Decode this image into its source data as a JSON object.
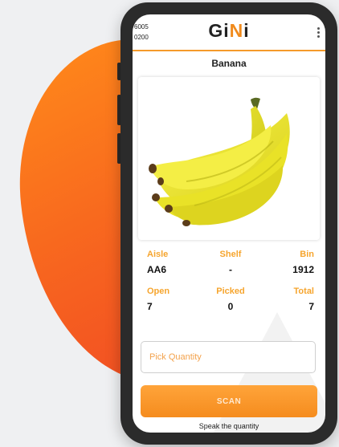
{
  "status": {
    "line1": "6005",
    "line2": "0200"
  },
  "app": {
    "logo_prefix": "Gi",
    "logo_accent_letter": "N",
    "logo_suffix": "i"
  },
  "product": {
    "name": "Banana"
  },
  "location": {
    "aisle_label": "Aisle",
    "aisle_value": "AA6",
    "shelf_label": "Shelf",
    "shelf_value": "-",
    "bin_label": "Bin",
    "bin_value": "1912"
  },
  "counts": {
    "open_label": "Open",
    "open_value": "7",
    "picked_label": "Picked",
    "picked_value": "0",
    "total_label": "Total",
    "total_value": "7"
  },
  "input": {
    "placeholder": "Pick Quantity",
    "value": ""
  },
  "actions": {
    "scan_label": "SCAN",
    "speak_label": "Speak the quantity"
  },
  "icons": {
    "menu": "more-vertical-icon"
  },
  "colors": {
    "accent": "#f59a2a",
    "label": "#f6a52e",
    "button": "#f58c1e"
  }
}
